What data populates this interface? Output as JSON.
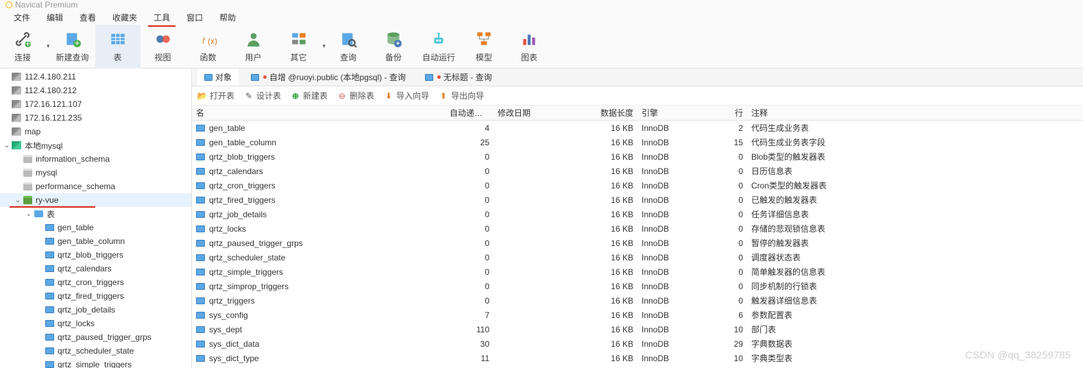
{
  "app_title": "Navicat Premium",
  "menus": [
    "文件",
    "编辑",
    "查看",
    "收藏夹",
    "工具",
    "窗口",
    "帮助"
  ],
  "menus_hl_index": 4,
  "toolbar": [
    {
      "id": "connect",
      "label": "连接",
      "arrow": true
    },
    {
      "id": "newquery",
      "label": "新建查询"
    },
    {
      "id": "table",
      "label": "表",
      "active": true
    },
    {
      "id": "view",
      "label": "视图"
    },
    {
      "id": "function",
      "label": "函数"
    },
    {
      "id": "user",
      "label": "用户"
    },
    {
      "id": "other",
      "label": "其它",
      "arrow": true
    },
    {
      "id": "query",
      "label": "查询"
    },
    {
      "id": "backup",
      "label": "备份"
    },
    {
      "id": "autorun",
      "label": "自动运行"
    },
    {
      "id": "model",
      "label": "模型"
    },
    {
      "id": "chart",
      "label": "图表"
    }
  ],
  "tree": [
    {
      "lvl": 0,
      "type": "srv",
      "label": "112.4.180.211"
    },
    {
      "lvl": 0,
      "type": "srv",
      "label": "112.4.180.212"
    },
    {
      "lvl": 0,
      "type": "srv",
      "label": "172.16.121.107"
    },
    {
      "lvl": 0,
      "type": "srv",
      "label": "172.16.121.235"
    },
    {
      "lvl": 0,
      "type": "srv",
      "label": "map"
    },
    {
      "lvl": 0,
      "type": "srv",
      "label": "本地mysql",
      "open": true,
      "on": true
    },
    {
      "lvl": 1,
      "type": "db",
      "label": "information_schema"
    },
    {
      "lvl": 1,
      "type": "db",
      "label": "mysql"
    },
    {
      "lvl": 1,
      "type": "db",
      "label": "performance_schema"
    },
    {
      "lvl": 1,
      "type": "db",
      "label": "ry-vue",
      "open": true,
      "on": true,
      "sel": true
    },
    {
      "lvl": 2,
      "type": "folder",
      "label": "表",
      "open": true,
      "on": true
    },
    {
      "lvl": 3,
      "type": "tbl",
      "label": "gen_table"
    },
    {
      "lvl": 3,
      "type": "tbl",
      "label": "gen_table_column"
    },
    {
      "lvl": 3,
      "type": "tbl",
      "label": "qrtz_blob_triggers"
    },
    {
      "lvl": 3,
      "type": "tbl",
      "label": "qrtz_calendars"
    },
    {
      "lvl": 3,
      "type": "tbl",
      "label": "qrtz_cron_triggers"
    },
    {
      "lvl": 3,
      "type": "tbl",
      "label": "qrtz_fired_triggers"
    },
    {
      "lvl": 3,
      "type": "tbl",
      "label": "qrtz_job_details"
    },
    {
      "lvl": 3,
      "type": "tbl",
      "label": "qrtz_locks"
    },
    {
      "lvl": 3,
      "type": "tbl",
      "label": "qrtz_paused_trigger_grps"
    },
    {
      "lvl": 3,
      "type": "tbl",
      "label": "qrtz_scheduler_state"
    },
    {
      "lvl": 3,
      "type": "tbl",
      "label": "qrtz_simple_triggers"
    }
  ],
  "tabs": [
    {
      "label": "对象",
      "active": true
    },
    {
      "label": "自增 @ruoyi.public (本地pgsql) - 查询",
      "dirty": true
    },
    {
      "label": "无标题 - 查询",
      "dirty": true
    }
  ],
  "actions": {
    "open": "打开表",
    "design": "设计表",
    "new": "新建表",
    "delete": "删除表",
    "import": "导入向导",
    "export": "导出向导"
  },
  "columns": {
    "name": "名",
    "auto": "自动递增值",
    "mod": "修改日期",
    "len": "数据长度",
    "eng": "引擎",
    "rows": "行",
    "comm": "注释"
  },
  "rows": [
    {
      "name": "gen_table",
      "auto": "4",
      "len": "16 KB",
      "eng": "InnoDB",
      "rows": "2",
      "comm": "代码生成业务表"
    },
    {
      "name": "gen_table_column",
      "auto": "25",
      "len": "16 KB",
      "eng": "InnoDB",
      "rows": "15",
      "comm": "代码生成业务表字段"
    },
    {
      "name": "qrtz_blob_triggers",
      "auto": "0",
      "len": "16 KB",
      "eng": "InnoDB",
      "rows": "0",
      "comm": "Blob类型的触发器表"
    },
    {
      "name": "qrtz_calendars",
      "auto": "0",
      "len": "16 KB",
      "eng": "InnoDB",
      "rows": "0",
      "comm": "日历信息表"
    },
    {
      "name": "qrtz_cron_triggers",
      "auto": "0",
      "len": "16 KB",
      "eng": "InnoDB",
      "rows": "0",
      "comm": "Cron类型的触发器表"
    },
    {
      "name": "qrtz_fired_triggers",
      "auto": "0",
      "len": "16 KB",
      "eng": "InnoDB",
      "rows": "0",
      "comm": "已触发的触发器表"
    },
    {
      "name": "qrtz_job_details",
      "auto": "0",
      "len": "16 KB",
      "eng": "InnoDB",
      "rows": "0",
      "comm": "任务详细信息表"
    },
    {
      "name": "qrtz_locks",
      "auto": "0",
      "len": "16 KB",
      "eng": "InnoDB",
      "rows": "0",
      "comm": "存储的悲观锁信息表"
    },
    {
      "name": "qrtz_paused_trigger_grps",
      "auto": "0",
      "len": "16 KB",
      "eng": "InnoDB",
      "rows": "0",
      "comm": "暂停的触发器表"
    },
    {
      "name": "qrtz_scheduler_state",
      "auto": "0",
      "len": "16 KB",
      "eng": "InnoDB",
      "rows": "0",
      "comm": "调度器状态表"
    },
    {
      "name": "qrtz_simple_triggers",
      "auto": "0",
      "len": "16 KB",
      "eng": "InnoDB",
      "rows": "0",
      "comm": "简单触发器的信息表"
    },
    {
      "name": "qrtz_simprop_triggers",
      "auto": "0",
      "len": "16 KB",
      "eng": "InnoDB",
      "rows": "0",
      "comm": "同步机制的行锁表"
    },
    {
      "name": "qrtz_triggers",
      "auto": "0",
      "len": "16 KB",
      "eng": "InnoDB",
      "rows": "0",
      "comm": "触发器详细信息表"
    },
    {
      "name": "sys_config",
      "auto": "7",
      "len": "16 KB",
      "eng": "InnoDB",
      "rows": "6",
      "comm": "参数配置表"
    },
    {
      "name": "sys_dept",
      "auto": "110",
      "len": "16 KB",
      "eng": "InnoDB",
      "rows": "10",
      "comm": "部门表"
    },
    {
      "name": "sys_dict_data",
      "auto": "30",
      "len": "16 KB",
      "eng": "InnoDB",
      "rows": "29",
      "comm": "字典数据表"
    },
    {
      "name": "sys_dict_type",
      "auto": "11",
      "len": "16 KB",
      "eng": "InnoDB",
      "rows": "10",
      "comm": "字典类型表"
    }
  ],
  "watermark": "CSDN @qq_38259785"
}
